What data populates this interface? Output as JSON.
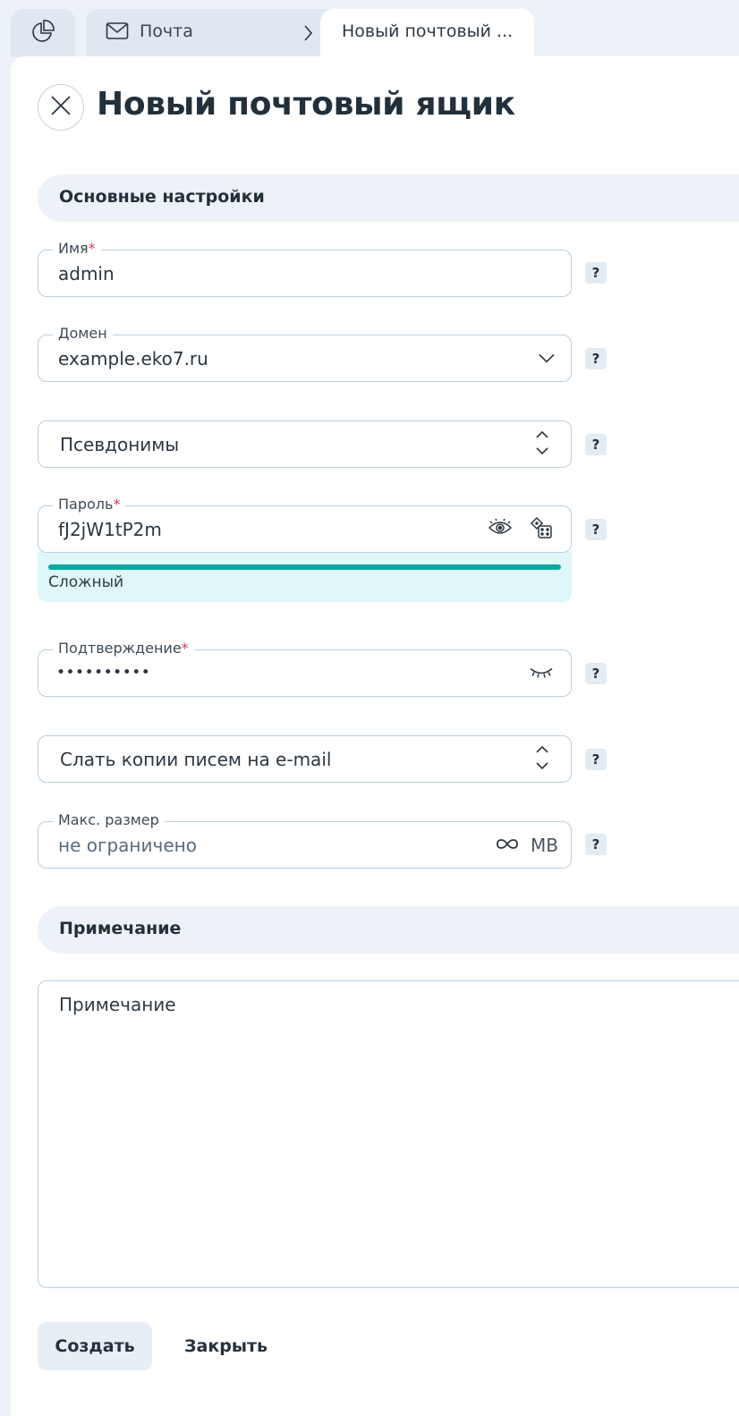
{
  "tabs": {
    "mail_label": "Почта",
    "active_label": "Новый почтовый ..."
  },
  "page": {
    "title": "Новый почтовый ящик"
  },
  "sections": {
    "main": "Основные настройки",
    "note": "Примечание"
  },
  "fields": {
    "name": {
      "label": "Имя",
      "required": "*",
      "value": "admin"
    },
    "domain": {
      "label": "Домен",
      "value": "example.eko7.ru"
    },
    "aliases": {
      "value": "Псевдонимы"
    },
    "password": {
      "label": "Пароль",
      "required": "*",
      "value": "fJ2jW1tP2m",
      "strength": "Сложный",
      "strength_level": 1.0
    },
    "confirm": {
      "label": "Подтверждение",
      "required": "*",
      "value": "••••••••••"
    },
    "copies": {
      "value": "Слать копии писем на e-mail"
    },
    "max_size": {
      "label": "Макс. размер",
      "placeholder": "не ограничено",
      "unit": "MB"
    },
    "note": {
      "placeholder": "Примечание"
    }
  },
  "help_label": "?",
  "buttons": {
    "create": "Создать",
    "close": "Закрыть"
  },
  "colors": {
    "accent": "#0ba8a3",
    "required": "#e0356a",
    "section_bg": "#edf2f8"
  },
  "icons": [
    "pie-chart-icon",
    "envelope-icon",
    "chevron-right-icon",
    "close-icon",
    "chevron-down-icon",
    "updown-icon",
    "eye-icon",
    "dice-icon",
    "eye-closed-icon",
    "infinity-icon"
  ]
}
